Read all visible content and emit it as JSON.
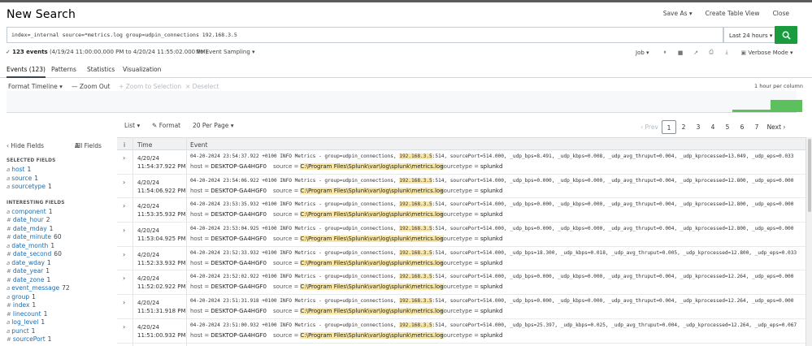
{
  "header": {
    "title": "New Search",
    "save_as": "Save As ▾",
    "create_table_view": "Create Table View",
    "close": "Close"
  },
  "search": {
    "query": "index=_internal source=*metrics.log group=udpin_connections 192.168.3.5",
    "time_range": "Last 24 hours ▾",
    "search_icon": "search-icon"
  },
  "status": {
    "check": "✓",
    "count": "123 events",
    "range": "(4/19/24 11:00:00.000 PM to 4/20/24 11:55:02.000 PM)",
    "sampling": "No Event Sampling ▾",
    "job": "Job ▾",
    "verbose": "Verbose Mode ▾"
  },
  "tabs": [
    {
      "label": "Events (123)"
    },
    {
      "label": "Patterns"
    },
    {
      "label": "Statistics"
    },
    {
      "label": "Visualization"
    }
  ],
  "timeline": {
    "format": "Format Timeline ▾",
    "zoom_out": "— Zoom Out",
    "zoom_selection": "+ Zoom to Selection",
    "deselect": "× Deselect",
    "scale": "1 hour per column"
  },
  "pager": {
    "list": "List ▾",
    "format": "Format",
    "per_page": "20 Per Page ▾",
    "prev": "‹ Prev",
    "pages": [
      "1",
      "2",
      "3",
      "4",
      "5",
      "6",
      "7"
    ],
    "next": "Next ›"
  },
  "sidebar": {
    "hide_fields": "‹ Hide Fields",
    "all_fields": "All Fields",
    "selected_title": "SELECTED FIELDS",
    "selected": [
      {
        "type": "a",
        "name": "host",
        "count": "1"
      },
      {
        "type": "a",
        "name": "source",
        "count": "1"
      },
      {
        "type": "a",
        "name": "sourcetype",
        "count": "1"
      }
    ],
    "interesting_title": "INTERESTING FIELDS",
    "interesting": [
      {
        "type": "a",
        "name": "component",
        "count": "1"
      },
      {
        "type": "#",
        "name": "date_hour",
        "count": "2"
      },
      {
        "type": "#",
        "name": "date_mday",
        "count": "1"
      },
      {
        "type": "#",
        "name": "date_minute",
        "count": "60"
      },
      {
        "type": "a",
        "name": "date_month",
        "count": "1"
      },
      {
        "type": "#",
        "name": "date_second",
        "count": "60"
      },
      {
        "type": "a",
        "name": "date_wday",
        "count": "1"
      },
      {
        "type": "#",
        "name": "date_year",
        "count": "1"
      },
      {
        "type": "#",
        "name": "date_zone",
        "count": "1"
      },
      {
        "type": "a",
        "name": "event_message",
        "count": "72"
      },
      {
        "type": "a",
        "name": "group",
        "count": "1"
      },
      {
        "type": "#",
        "name": "index",
        "count": "1"
      },
      {
        "type": "#",
        "name": "linecount",
        "count": "1"
      },
      {
        "type": "a",
        "name": "log_level",
        "count": "1"
      },
      {
        "type": "a",
        "name": "punct",
        "count": "1"
      },
      {
        "type": "#",
        "name": "sourcePort",
        "count": "1"
      }
    ]
  },
  "table": {
    "info_col": "i",
    "time_col": "Time",
    "event_col": "Event",
    "host_label": "host =",
    "source_label": "source =",
    "sourcetype_label": "sourcetype =",
    "host": "DESKTOP-GA4HGF0",
    "source": "C:\\Program Files\\Splunk\\var\\log\\splunk\\metrics.log",
    "sourcetype": "splunkd",
    "ip": "192.168.3.5",
    "rows": [
      {
        "date": "4/20/24",
        "time": "11:54:37.922 PM",
        "pre": "04-20-2024 23:54:37.922 +0100 INFO  Metrics - group=udpin_connections, ",
        "post": ":514, sourcePort=514.000, _udp_bps=8.491, _udp_kbps=0.008, _udp_avg_thruput=0.004, _udp_kprocessed=13.049, _udp_eps=0.033"
      },
      {
        "date": "4/20/24",
        "time": "11:54:06.922 PM",
        "pre": "04-20-2024 23:54:06.922 +0100 INFO  Metrics - group=udpin_connections, ",
        "post": ":514, sourcePort=514.000, _udp_bps=0.000, _udp_kbps=0.000, _udp_avg_thruput=0.004, _udp_kprocessed=12.800, _udp_eps=0.000"
      },
      {
        "date": "4/20/24",
        "time": "11:53:35.932 PM",
        "pre": "04-20-2024 23:53:35.932 +0100 INFO  Metrics - group=udpin_connections, ",
        "post": ":514, sourcePort=514.000, _udp_bps=0.000, _udp_kbps=0.000, _udp_avg_thruput=0.004, _udp_kprocessed=12.800, _udp_eps=0.000"
      },
      {
        "date": "4/20/24",
        "time": "11:53:04.925 PM",
        "pre": "04-20-2024 23:53:04.925 +0100 INFO  Metrics - group=udpin_connections, ",
        "post": ":514, sourcePort=514.000, _udp_bps=0.000, _udp_kbps=0.000, _udp_avg_thruput=0.004, _udp_kprocessed=12.800, _udp_eps=0.000"
      },
      {
        "date": "4/20/24",
        "time": "11:52:33.932 PM",
        "pre": "04-20-2024 23:52:33.932 +0100 INFO  Metrics - group=udpin_connections, ",
        "post": ":514, sourcePort=514.000, _udp_bps=18.300, _udp_kbps=0.018, _udp_avg_thruput=0.005, _udp_kprocessed=12.800, _udp_eps=0.033"
      },
      {
        "date": "4/20/24",
        "time": "11:52:02.922 PM",
        "pre": "04-20-2024 23:52:02.922 +0100 INFO  Metrics - group=udpin_connections, ",
        "post": ":514, sourcePort=514.000, _udp_bps=0.000, _udp_kbps=0.000, _udp_avg_thruput=0.004, _udp_kprocessed=12.264, _udp_eps=0.000"
      },
      {
        "date": "4/20/24",
        "time": "11:51:31.918 PM",
        "pre": "04-20-2024 23:51:31.918 +0100 INFO  Metrics - group=udpin_connections, ",
        "post": ":514, sourcePort=514.000, _udp_bps=0.000, _udp_kbps=0.000, _udp_avg_thruput=0.004, _udp_kprocessed=12.264, _udp_eps=0.000"
      },
      {
        "date": "4/20/24",
        "time": "11:51:00.932 PM",
        "pre": "04-20-2024 23:51:00.932 +0100 INFO  Metrics - group=udpin_connections, ",
        "post": ":514, sourcePort=514.000, _udp_bps=25.397, _udp_kbps=0.025, _udp_avg_thruput=0.004, _udp_kprocessed=12.264, _udp_eps=0.067"
      }
    ]
  }
}
